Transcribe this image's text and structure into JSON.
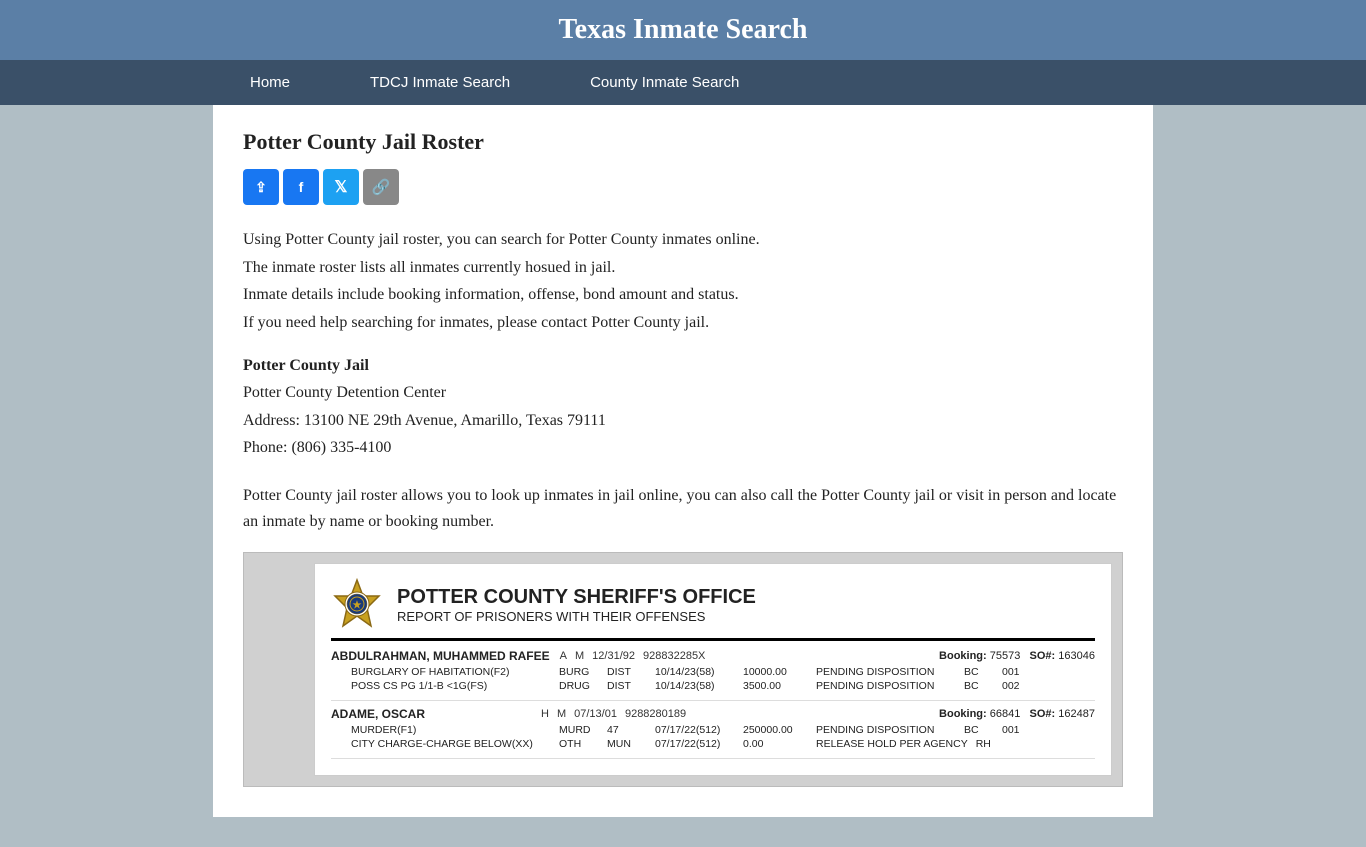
{
  "header": {
    "title": "Texas Inmate Search",
    "background_color": "#5b7fa6"
  },
  "nav": {
    "items": [
      {
        "label": "Home",
        "href": "#"
      },
      {
        "label": "TDCJ Inmate Search",
        "href": "#"
      },
      {
        "label": "County Inmate Search",
        "href": "#"
      }
    ]
  },
  "page": {
    "heading": "Potter County Jail Roster",
    "share_buttons": [
      {
        "label": "⇪",
        "type": "share-general",
        "title": "Share"
      },
      {
        "label": "f",
        "type": "share-facebook",
        "title": "Facebook"
      },
      {
        "label": "🐦",
        "type": "share-twitter",
        "title": "Twitter"
      },
      {
        "label": "🔗",
        "type": "share-link",
        "title": "Copy Link"
      }
    ],
    "description": [
      "Using Potter County jail roster, you can search for Potter County inmates online.",
      "The inmate roster lists all inmates currently hosued in jail.",
      "Inmate details include booking information, offense, bond amount and status.",
      "If you need help searching for inmates, please contact Potter County jail."
    ],
    "jail_info": {
      "name": "Potter County Jail",
      "facility": "Potter County Detention Center",
      "address": "Address: 13100 NE 29th Avenue, Amarillo, Texas 79111",
      "phone": "Phone: (806) 335-4100"
    },
    "roster_para": "Potter County jail roster allows you to look up inmates in jail online, you can also call the Potter County jail or visit in person and locate an inmate by name or booking number.",
    "preview": {
      "agency": "POTTER COUNTY SHERIFF'S OFFICE",
      "report_title": "REPORT OF PRISONERS WITH THEIR OFFENSES",
      "inmates": [
        {
          "name": "ABDULRAHMAN, MUHAMMED RAFEE",
          "race": "A",
          "sex": "M",
          "dob": "12/31/92",
          "sid": "928832285X",
          "booking_label": "Booking:",
          "booking_num": "75573",
          "so_label": "SO#:",
          "so_num": "163046",
          "charges": [
            {
              "name": "BURGLARY OF HABITATION(F2)",
              "cat": "BURG",
              "type": "DIST",
              "date": "10/14/23(58)",
              "amount": "10000.00",
              "status": "PENDING DISPOSITION",
              "extra": "BC",
              "num": "001"
            },
            {
              "name": "POSS CS PG 1/1-B <1G(FS)",
              "cat": "DRUG",
              "type": "DIST",
              "date": "10/14/23(58)",
              "amount": "3500.00",
              "status": "PENDING DISPOSITION",
              "extra": "BC",
              "num": "002"
            }
          ]
        },
        {
          "name": "ADAME, OSCAR",
          "race": "H",
          "sex": "M",
          "dob": "07/13/01",
          "sid": "9288280189",
          "booking_label": "Booking:",
          "booking_num": "66841",
          "so_label": "SO#:",
          "so_num": "162487",
          "charges": [
            {
              "name": "MURDER(F1)",
              "cat": "MURD",
              "type": "47",
              "date": "07/17/22(512)",
              "amount": "250000.00",
              "status": "PENDING DISPOSITION",
              "extra": "BC",
              "num": "001"
            },
            {
              "name": "CITY CHARGE-CHARGE BELOW(XX)",
              "cat": "OTH",
              "type": "MUN",
              "date": "07/17/22(512)",
              "amount": "0.00",
              "status": "RELEASE HOLD PER AGENCY",
              "extra": "RH",
              "num": ""
            }
          ]
        }
      ]
    }
  }
}
